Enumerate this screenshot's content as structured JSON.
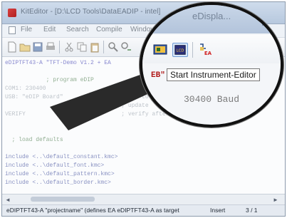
{
  "window": {
    "title": "KitEditor - [D:\\LCD Tools\\DataEADIP - intel]"
  },
  "menu": {
    "items": [
      "File",
      "Edit",
      "Search",
      "Compile",
      "Window"
    ]
  },
  "toolbar": {
    "icons": [
      "new-file-icon",
      "open-folder-icon",
      "save-icon",
      "print-icon",
      "cut-icon",
      "copy-icon",
      "paste-icon",
      "find-icon",
      "find-replace-icon",
      "instrument-editor-icon",
      "lcd-icon",
      "ea-tool-icon"
    ]
  },
  "magnifier": {
    "title_fragment": "eDispla...",
    "tooltip": "Start Instrument-Editor",
    "code_fragment": "EB\"",
    "baud_text": "30400 Baud"
  },
  "editor": {
    "lines": [
      {
        "text": "eDIPTFT43-A \"TFT-Demo V1.2 + EA",
        "kind": "code"
      },
      {
        "text": "",
        "kind": "code"
      },
      {
        "text": "            ; program eDIP",
        "kind": "comment"
      },
      {
        "text": "COM1: 230400",
        "kind": "blur"
      },
      {
        "text": "USB: \"eDIP Board\"                 ; use to eDIPTFT43 and tested b",
        "kind": "blur"
      },
      {
        "text": "                                  ; update",
        "kind": "blur"
      },
      {
        "text": "VERIFY                            ; verify after program",
        "kind": "blur"
      },
      {
        "text": "",
        "kind": "code"
      },
      {
        "text": "",
        "kind": "code"
      },
      {
        "text": "  ; load defaults",
        "kind": "comment"
      },
      {
        "text": "",
        "kind": "code"
      },
      {
        "text": "include <..\\default_constant.kmc>",
        "kind": "code"
      },
      {
        "text": "include <..\\default_font.kmc>",
        "kind": "code"
      },
      {
        "text": "include <..\\default_pattern.kmc>",
        "kind": "code"
      },
      {
        "text": "include <..\\default_border.kmc>",
        "kind": "code"
      }
    ]
  },
  "statusbar": {
    "message": "eDIPTFT43-A \"projectname\" (defines EA eDIPTFT43-A as target",
    "mode": "Insert",
    "position": "3 / 1"
  },
  "colors": {
    "lens_border": "#111111",
    "pointer": "#2a2a2a",
    "highlight": "#6f9ad4"
  }
}
